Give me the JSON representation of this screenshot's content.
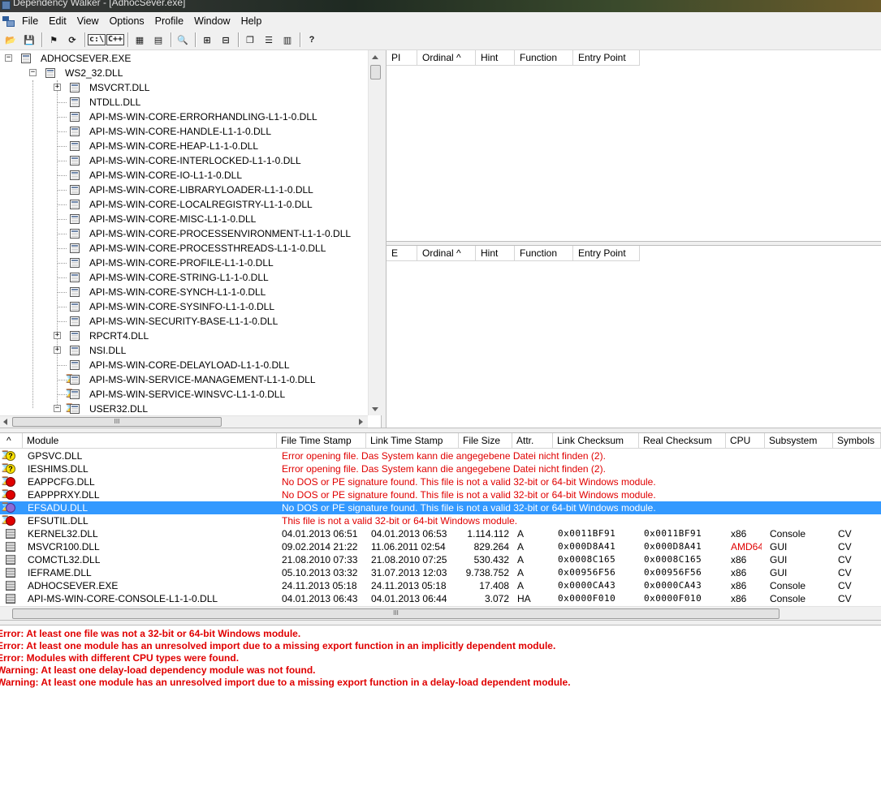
{
  "window": {
    "title": "Dependency Walker - [AdhocSever.exe]"
  },
  "menu": [
    "File",
    "Edit",
    "View",
    "Options",
    "Profile",
    "Window",
    "Help"
  ],
  "toolbar": {
    "buttons": [
      {
        "name": "open-icon",
        "glyph": "📂"
      },
      {
        "name": "save-icon",
        "glyph": "💾"
      },
      {
        "name": "profile-icon",
        "glyph": "⚑"
      },
      {
        "name": "refresh-icon",
        "glyph": "⟳"
      },
      {
        "name": "full-paths-icon",
        "glyph": "c:\\"
      },
      {
        "name": "undecorate-icon",
        "glyph": "C++"
      },
      {
        "name": "view-module-icon",
        "glyph": "▦"
      },
      {
        "name": "properties-icon",
        "glyph": "▤"
      },
      {
        "name": "find-icon",
        "glyph": "🔍"
      },
      {
        "name": "expand-all-icon",
        "glyph": "⊞"
      },
      {
        "name": "collapse-all-icon",
        "glyph": "⊟"
      },
      {
        "name": "cascade-icon",
        "glyph": "❐"
      },
      {
        "name": "tile-horizontal-icon",
        "glyph": "☰"
      },
      {
        "name": "tile-vertical-icon",
        "glyph": "▥"
      },
      {
        "name": "help-icon",
        "glyph": "?"
      }
    ]
  },
  "tree": {
    "root": "ADHOCSEVER.EXE",
    "child": "WS2_32.DLL",
    "items": [
      {
        "label": "MSVCRT.DLL",
        "expandable": true,
        "type": "normal"
      },
      {
        "label": "NTDLL.DLL",
        "expandable": false,
        "type": "normal"
      },
      {
        "label": "API-MS-WIN-CORE-ERRORHANDLING-L1-1-0.DLL",
        "expandable": false,
        "type": "normal"
      },
      {
        "label": "API-MS-WIN-CORE-HANDLE-L1-1-0.DLL",
        "expandable": false,
        "type": "normal"
      },
      {
        "label": "API-MS-WIN-CORE-HEAP-L1-1-0.DLL",
        "expandable": false,
        "type": "normal"
      },
      {
        "label": "API-MS-WIN-CORE-INTERLOCKED-L1-1-0.DLL",
        "expandable": false,
        "type": "normal"
      },
      {
        "label": "API-MS-WIN-CORE-IO-L1-1-0.DLL",
        "expandable": false,
        "type": "normal"
      },
      {
        "label": "API-MS-WIN-CORE-LIBRARYLOADER-L1-1-0.DLL",
        "expandable": false,
        "type": "normal"
      },
      {
        "label": "API-MS-WIN-CORE-LOCALREGISTRY-L1-1-0.DLL",
        "expandable": false,
        "type": "normal"
      },
      {
        "label": "API-MS-WIN-CORE-MISC-L1-1-0.DLL",
        "expandable": false,
        "type": "normal"
      },
      {
        "label": "API-MS-WIN-CORE-PROCESSENVIRONMENT-L1-1-0.DLL",
        "expandable": false,
        "type": "normal"
      },
      {
        "label": "API-MS-WIN-CORE-PROCESSTHREADS-L1-1-0.DLL",
        "expandable": false,
        "type": "normal"
      },
      {
        "label": "API-MS-WIN-CORE-PROFILE-L1-1-0.DLL",
        "expandable": false,
        "type": "normal"
      },
      {
        "label": "API-MS-WIN-CORE-STRING-L1-1-0.DLL",
        "expandable": false,
        "type": "normal"
      },
      {
        "label": "API-MS-WIN-CORE-SYNCH-L1-1-0.DLL",
        "expandable": false,
        "type": "normal"
      },
      {
        "label": "API-MS-WIN-CORE-SYSINFO-L1-1-0.DLL",
        "expandable": false,
        "type": "normal"
      },
      {
        "label": "API-MS-WIN-SECURITY-BASE-L1-1-0.DLL",
        "expandable": false,
        "type": "normal"
      },
      {
        "label": "RPCRT4.DLL",
        "expandable": true,
        "type": "normal"
      },
      {
        "label": "NSI.DLL",
        "expandable": true,
        "type": "normal"
      },
      {
        "label": "API-MS-WIN-CORE-DELAYLOAD-L1-1-0.DLL",
        "expandable": false,
        "type": "normal"
      },
      {
        "label": "API-MS-WIN-SERVICE-MANAGEMENT-L1-1-0.DLL",
        "expandable": false,
        "type": "delay"
      },
      {
        "label": "API-MS-WIN-SERVICE-WINSVC-L1-1-0.DLL",
        "expandable": false,
        "type": "delay"
      },
      {
        "label": "USER32.DLL",
        "expandable": true,
        "type": "delay",
        "collapse": true
      }
    ]
  },
  "import_pane": {
    "headers": [
      "PI",
      "Ordinal ^",
      "Hint",
      "Function",
      "Entry Point"
    ]
  },
  "export_pane": {
    "headers": [
      "E",
      "Ordinal ^",
      "Hint",
      "Function",
      "Entry Point"
    ]
  },
  "module_list": {
    "headers": [
      "^",
      "Module",
      "File Time Stamp",
      "Link Time Stamp",
      "File Size",
      "Attr.",
      "Link Checksum",
      "Real Checksum",
      "CPU",
      "Subsystem",
      "Symbols"
    ],
    "rows": [
      {
        "status": "missing",
        "module": "GPSVC.DLL",
        "message": "Error opening file. Das System kann die angegebene Datei nicht finden (2)."
      },
      {
        "status": "missing",
        "module": "IESHIMS.DLL",
        "message": "Error opening file. Das System kann die angegebene Datei nicht finden (2)."
      },
      {
        "status": "error",
        "module": "EAPPCFG.DLL",
        "message": "No DOS or PE signature found. This file is not a valid 32-bit or 64-bit Windows module."
      },
      {
        "status": "error",
        "module": "EAPPPRXY.DLL",
        "message": "No DOS or PE signature found. This file is not a valid 32-bit or 64-bit Windows module."
      },
      {
        "status": "error-purple",
        "module": "EFSADU.DLL",
        "message": "No DOS or PE signature found. This file is not a valid 32-bit or 64-bit Windows module.",
        "selected": true
      },
      {
        "status": "error",
        "module": "EFSUTIL.DLL",
        "message": "This file is not a valid 32-bit or 64-bit Windows module."
      },
      {
        "status": "ok",
        "module": "KERNEL32.DLL",
        "file_ts": "04.01.2013 06:51",
        "link_ts": "04.01.2013 06:53",
        "size": "1.114.112",
        "attr": "A",
        "link_cs": "0x0011BF91",
        "real_cs": "0x0011BF91",
        "cpu": "x86",
        "subsystem": "Console",
        "symbols": "CV"
      },
      {
        "status": "ok",
        "module": "MSVCR100.DLL",
        "file_ts": "09.02.2014 21:22",
        "link_ts": "11.06.2011 02:54",
        "size": "829.264",
        "attr": "A",
        "link_cs": "0x000D8A41",
        "real_cs": "0x000D8A41",
        "cpu": "AMD64",
        "cpu_error": true,
        "subsystem": "GUI",
        "symbols": "CV"
      },
      {
        "status": "ok",
        "module": "COMCTL32.DLL",
        "file_ts": "21.08.2010 07:33",
        "link_ts": "21.08.2010 07:25",
        "size": "530.432",
        "attr": "A",
        "link_cs": "0x0008C165",
        "real_cs": "0x0008C165",
        "cpu": "x86",
        "subsystem": "GUI",
        "symbols": "CV"
      },
      {
        "status": "ok",
        "module": "IEFRAME.DLL",
        "file_ts": "05.10.2013 03:32",
        "link_ts": "31.07.2013 12:03",
        "size": "9.738.752",
        "attr": "A",
        "link_cs": "0x00956F56",
        "real_cs": "0x00956F56",
        "cpu": "x86",
        "subsystem": "GUI",
        "symbols": "CV"
      },
      {
        "status": "ok-plain",
        "module": "ADHOCSEVER.EXE",
        "file_ts": "24.11.2013 05:18",
        "link_ts": "24.11.2013 05:18",
        "size": "17.408",
        "attr": "A",
        "link_cs": "0x0000CA43",
        "real_cs": "0x0000CA43",
        "cpu": "x86",
        "subsystem": "Console",
        "symbols": "CV"
      },
      {
        "status": "ok-plain",
        "module": "API-MS-WIN-CORE-CONSOLE-L1-1-0.DLL",
        "file_ts": "04.01.2013 06:43",
        "link_ts": "04.01.2013 06:44",
        "size": "3.072",
        "attr": "HA",
        "link_cs": "0x0000F010",
        "real_cs": "0x0000F010",
        "cpu": "x86",
        "subsystem": "Console",
        "symbols": "CV"
      }
    ]
  },
  "log": [
    "Error: At least one file was not a 32-bit or 64-bit Windows module.",
    "Error: At least one module has an unresolved import due to a missing export function in an implicitly dependent module.",
    "Error: Modules with different CPU types were found.",
    "Warning: At least one delay-load dependency module was not found.",
    "Warning: At least one module has an unresolved import due to a missing export function in a delay-load dependent module."
  ],
  "scroll_thumb_glyph": "III"
}
